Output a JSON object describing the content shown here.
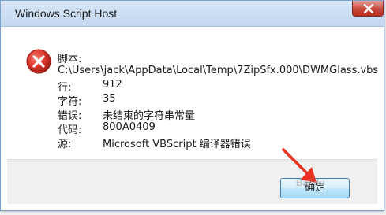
{
  "window": {
    "title": "Windows Script Host"
  },
  "error": {
    "icon": "error-icon",
    "fields": [
      {
        "label": "脚本:",
        "value": ""
      },
      {
        "label": "",
        "value": "C:\\Users\\jack\\AppData\\Local\\Temp\\7ZipSfx.000\\DWMGlass.vbs"
      },
      {
        "label": "行:",
        "value": "912"
      },
      {
        "label": "字符:",
        "value": "35"
      },
      {
        "label": "错误:",
        "value": "未结束的字符串常量"
      },
      {
        "label": "代码:",
        "value": "800A0409"
      },
      {
        "label": "源:",
        "value": "Microsoft VBScript 编译器错误"
      }
    ]
  },
  "buttons": {
    "ok_label": "确定"
  },
  "watermark": "Bai du",
  "colors": {
    "error_red": "#d9342b",
    "arrow_red": "#e8321f",
    "button_border": "#3c7fb1"
  }
}
